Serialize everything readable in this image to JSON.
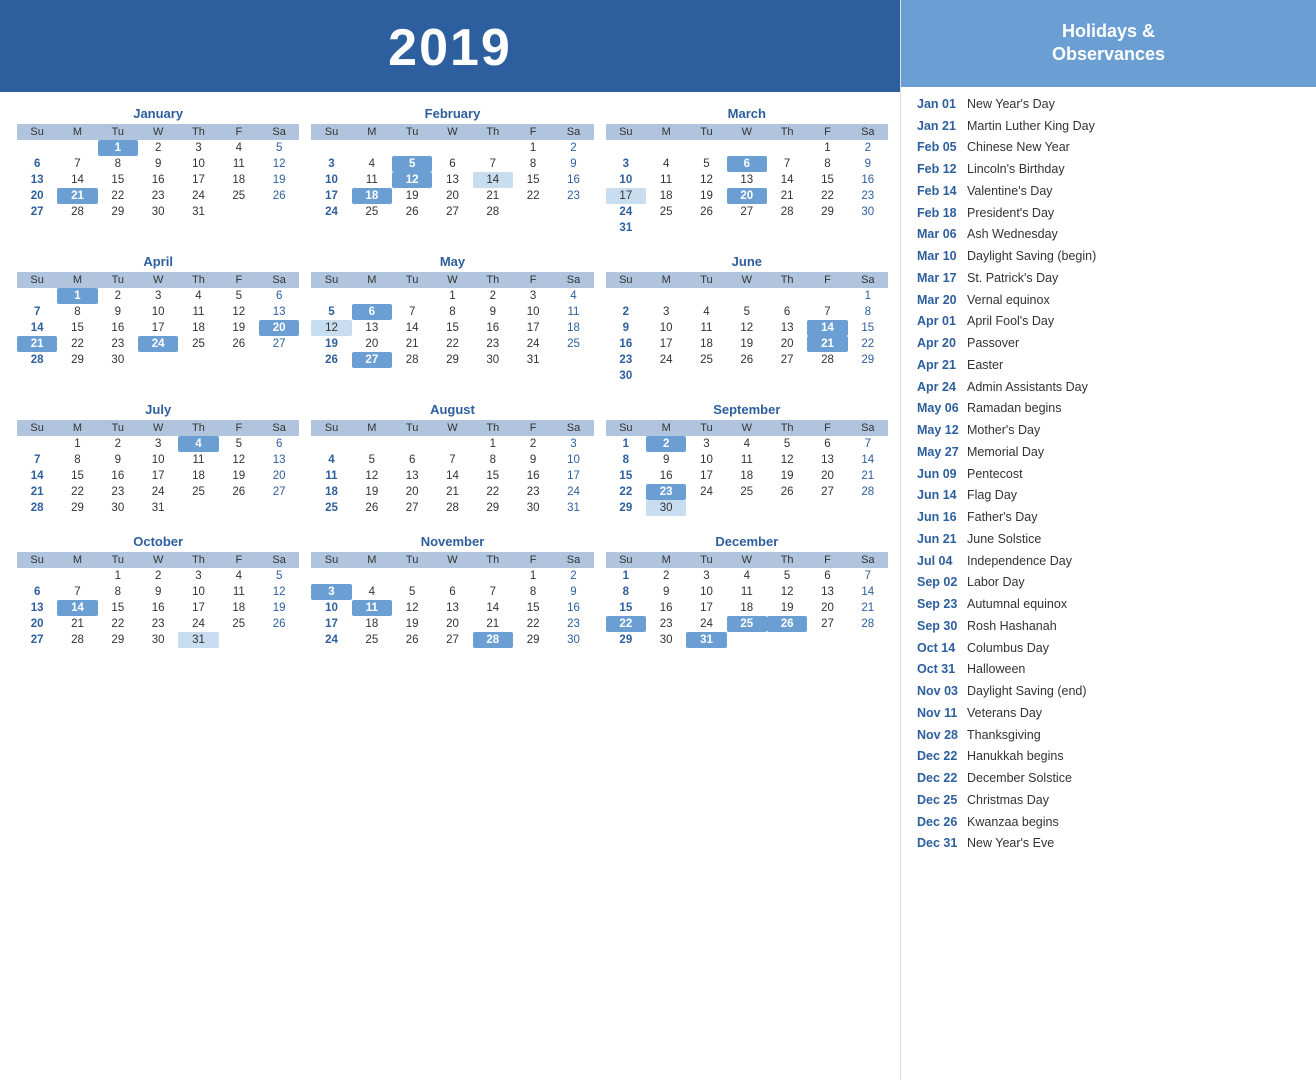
{
  "header": {
    "year": "2019"
  },
  "sidebar_header": "Holidays &\nObservances",
  "months": [
    {
      "name": "January",
      "days": [
        [
          "",
          "",
          "1",
          "2",
          "3",
          "4",
          "5"
        ],
        [
          "6",
          "7",
          "8",
          "9",
          "10",
          "11",
          "12"
        ],
        [
          "13",
          "14",
          "15",
          "16",
          "17",
          "18",
          "19"
        ],
        [
          "20",
          "21",
          "22",
          "23",
          "24",
          "25",
          "26"
        ],
        [
          "27",
          "28",
          "29",
          "30",
          "31",
          "",
          ""
        ]
      ],
      "highlights": {
        "1": "highlighted",
        "21": "highlighted"
      },
      "light": {}
    },
    {
      "name": "February",
      "days": [
        [
          "",
          "",
          "",
          "",
          "",
          "1",
          "2"
        ],
        [
          "3",
          "4",
          "5",
          "6",
          "7",
          "8",
          "9"
        ],
        [
          "10",
          "11",
          "12",
          "13",
          "14",
          "15",
          "16"
        ],
        [
          "17",
          "18",
          "19",
          "20",
          "21",
          "22",
          "23"
        ],
        [
          "24",
          "25",
          "26",
          "27",
          "28",
          "",
          ""
        ]
      ],
      "highlights": {
        "5": "highlighted",
        "12": "highlighted",
        "14": "light-highlight",
        "18": "highlighted"
      },
      "light": {}
    },
    {
      "name": "March",
      "days": [
        [
          "",
          "",
          "",
          "",
          "",
          "1",
          "2"
        ],
        [
          "3",
          "4",
          "5",
          "6",
          "7",
          "8",
          "9"
        ],
        [
          "10",
          "11",
          "12",
          "13",
          "14",
          "15",
          "16"
        ],
        [
          "17",
          "18",
          "19",
          "20",
          "21",
          "22",
          "23"
        ],
        [
          "24",
          "25",
          "26",
          "27",
          "28",
          "29",
          "30"
        ],
        [
          "31",
          "",
          "",
          "",
          "",
          "",
          ""
        ]
      ],
      "highlights": {
        "6": "highlighted",
        "17": "light-highlight",
        "20": "highlighted"
      },
      "light": {}
    },
    {
      "name": "April",
      "days": [
        [
          "",
          "1",
          "2",
          "3",
          "4",
          "5",
          "6"
        ],
        [
          "7",
          "8",
          "9",
          "10",
          "11",
          "12",
          "13"
        ],
        [
          "14",
          "15",
          "16",
          "17",
          "18",
          "19",
          "20"
        ],
        [
          "21",
          "22",
          "23",
          "24",
          "25",
          "26",
          "27"
        ],
        [
          "28",
          "29",
          "30",
          "",
          "",
          "",
          ""
        ]
      ],
      "highlights": {
        "1": "highlighted",
        "20": "highlighted",
        "21": "highlighted",
        "24": "highlighted"
      },
      "light": {}
    },
    {
      "name": "May",
      "days": [
        [
          "",
          "",
          "",
          "1",
          "2",
          "3",
          "4"
        ],
        [
          "5",
          "6",
          "7",
          "8",
          "9",
          "10",
          "11"
        ],
        [
          "12",
          "13",
          "14",
          "15",
          "16",
          "17",
          "18"
        ],
        [
          "19",
          "20",
          "21",
          "22",
          "23",
          "24",
          "25"
        ],
        [
          "26",
          "27",
          "28",
          "29",
          "30",
          "31",
          ""
        ]
      ],
      "highlights": {
        "6": "highlighted",
        "12": "light-highlight",
        "27": "highlighted"
      },
      "light": {}
    },
    {
      "name": "June",
      "days": [
        [
          "",
          "",
          "",
          "",
          "",
          "",
          "1"
        ],
        [
          "2",
          "3",
          "4",
          "5",
          "6",
          "7",
          "8"
        ],
        [
          "9",
          "10",
          "11",
          "12",
          "13",
          "14",
          "15"
        ],
        [
          "16",
          "17",
          "18",
          "19",
          "20",
          "21",
          "22"
        ],
        [
          "23",
          "24",
          "25",
          "26",
          "27",
          "28",
          "29"
        ],
        [
          "30",
          "",
          "",
          "",
          "",
          "",
          ""
        ]
      ],
      "highlights": {
        "14": "highlighted",
        "21": "highlighted"
      },
      "light": {}
    },
    {
      "name": "July",
      "days": [
        [
          "",
          "1",
          "2",
          "3",
          "4",
          "5",
          "6"
        ],
        [
          "7",
          "8",
          "9",
          "10",
          "11",
          "12",
          "13"
        ],
        [
          "14",
          "15",
          "16",
          "17",
          "18",
          "19",
          "20"
        ],
        [
          "21",
          "22",
          "23",
          "24",
          "25",
          "26",
          "27"
        ],
        [
          "28",
          "29",
          "30",
          "31",
          "",
          "",
          ""
        ]
      ],
      "highlights": {
        "4": "highlighted"
      },
      "light": {}
    },
    {
      "name": "August",
      "days": [
        [
          "",
          "",
          "",
          "",
          "1",
          "2",
          "3"
        ],
        [
          "4",
          "5",
          "6",
          "7",
          "8",
          "9",
          "10"
        ],
        [
          "11",
          "12",
          "13",
          "14",
          "15",
          "16",
          "17"
        ],
        [
          "18",
          "19",
          "20",
          "21",
          "22",
          "23",
          "24"
        ],
        [
          "25",
          "26",
          "27",
          "28",
          "29",
          "30",
          "31"
        ]
      ],
      "highlights": {},
      "light": {}
    },
    {
      "name": "September",
      "days": [
        [
          "1",
          "2",
          "3",
          "4",
          "5",
          "6",
          "7"
        ],
        [
          "8",
          "9",
          "10",
          "11",
          "12",
          "13",
          "14"
        ],
        [
          "15",
          "16",
          "17",
          "18",
          "19",
          "20",
          "21"
        ],
        [
          "22",
          "23",
          "24",
          "25",
          "26",
          "27",
          "28"
        ],
        [
          "29",
          "30",
          "",
          "",
          "",
          "",
          ""
        ]
      ],
      "highlights": {
        "2": "highlighted",
        "23": "highlighted",
        "30": "light-highlight"
      },
      "light": {}
    },
    {
      "name": "October",
      "days": [
        [
          "",
          "",
          "1",
          "2",
          "3",
          "4",
          "5"
        ],
        [
          "6",
          "7",
          "8",
          "9",
          "10",
          "11",
          "12"
        ],
        [
          "13",
          "14",
          "15",
          "16",
          "17",
          "18",
          "19"
        ],
        [
          "20",
          "21",
          "22",
          "23",
          "24",
          "25",
          "26"
        ],
        [
          "27",
          "28",
          "29",
          "30",
          "31",
          "",
          ""
        ]
      ],
      "highlights": {
        "14": "highlighted",
        "31": "light-highlight"
      },
      "light": {}
    },
    {
      "name": "November",
      "days": [
        [
          "",
          "",
          "",
          "",
          "",
          "1",
          "2"
        ],
        [
          "3",
          "4",
          "5",
          "6",
          "7",
          "8",
          "9"
        ],
        [
          "10",
          "11",
          "12",
          "13",
          "14",
          "15",
          "16"
        ],
        [
          "17",
          "18",
          "19",
          "20",
          "21",
          "22",
          "23"
        ],
        [
          "24",
          "25",
          "26",
          "27",
          "28",
          "29",
          "30"
        ]
      ],
      "highlights": {
        "3": "highlighted",
        "11": "highlighted",
        "28": "highlighted"
      },
      "light": {}
    },
    {
      "name": "December",
      "days": [
        [
          "1",
          "2",
          "3",
          "4",
          "5",
          "6",
          "7"
        ],
        [
          "8",
          "9",
          "10",
          "11",
          "12",
          "13",
          "14"
        ],
        [
          "15",
          "16",
          "17",
          "18",
          "19",
          "20",
          "21"
        ],
        [
          "22",
          "23",
          "24",
          "25",
          "26",
          "27",
          "28"
        ],
        [
          "29",
          "30",
          "31",
          "",
          "",
          "",
          ""
        ]
      ],
      "highlights": {
        "22": "highlighted",
        "25": "highlighted",
        "26": "highlighted",
        "31": "highlighted"
      },
      "light": {}
    }
  ],
  "holidays": [
    {
      "date": "Jan 01",
      "name": "New Year's Day"
    },
    {
      "date": "Jan 21",
      "name": "Martin Luther King Day"
    },
    {
      "date": "Feb 05",
      "name": "Chinese New Year"
    },
    {
      "date": "Feb 12",
      "name": "Lincoln's Birthday"
    },
    {
      "date": "Feb 14",
      "name": "Valentine's Day"
    },
    {
      "date": "Feb 18",
      "name": "President's Day"
    },
    {
      "date": "Mar 06",
      "name": "Ash Wednesday"
    },
    {
      "date": "Mar 10",
      "name": "Daylight Saving (begin)"
    },
    {
      "date": "Mar 17",
      "name": "St. Patrick's Day"
    },
    {
      "date": "Mar 20",
      "name": "Vernal equinox"
    },
    {
      "date": "Apr 01",
      "name": "April Fool's Day"
    },
    {
      "date": "Apr 20",
      "name": "Passover"
    },
    {
      "date": "Apr 21",
      "name": "Easter"
    },
    {
      "date": "Apr 24",
      "name": "Admin Assistants Day"
    },
    {
      "date": "May 06",
      "name": "Ramadan begins"
    },
    {
      "date": "May 12",
      "name": "Mother's Day"
    },
    {
      "date": "May 27",
      "name": "Memorial Day"
    },
    {
      "date": "Jun 09",
      "name": "Pentecost"
    },
    {
      "date": "Jun 14",
      "name": "Flag Day"
    },
    {
      "date": "Jun 16",
      "name": "Father's Day"
    },
    {
      "date": "Jun 21",
      "name": "June Solstice"
    },
    {
      "date": "Jul 04",
      "name": "Independence Day"
    },
    {
      "date": "Sep 02",
      "name": "Labor Day"
    },
    {
      "date": "Sep 23",
      "name": "Autumnal equinox"
    },
    {
      "date": "Sep 30",
      "name": "Rosh Hashanah"
    },
    {
      "date": "Oct 14",
      "name": "Columbus Day"
    },
    {
      "date": "Oct 31",
      "name": "Halloween"
    },
    {
      "date": "Nov 03",
      "name": "Daylight Saving (end)"
    },
    {
      "date": "Nov 11",
      "name": "Veterans Day"
    },
    {
      "date": "Nov 28",
      "name": "Thanksgiving"
    },
    {
      "date": "Dec 22",
      "name": "Hanukkah begins"
    },
    {
      "date": "Dec 22",
      "name": "December Solstice"
    },
    {
      "date": "Dec 25",
      "name": "Christmas Day"
    },
    {
      "date": "Dec 26",
      "name": "Kwanzaa begins"
    },
    {
      "date": "Dec 31",
      "name": "New Year's Eve"
    }
  ]
}
